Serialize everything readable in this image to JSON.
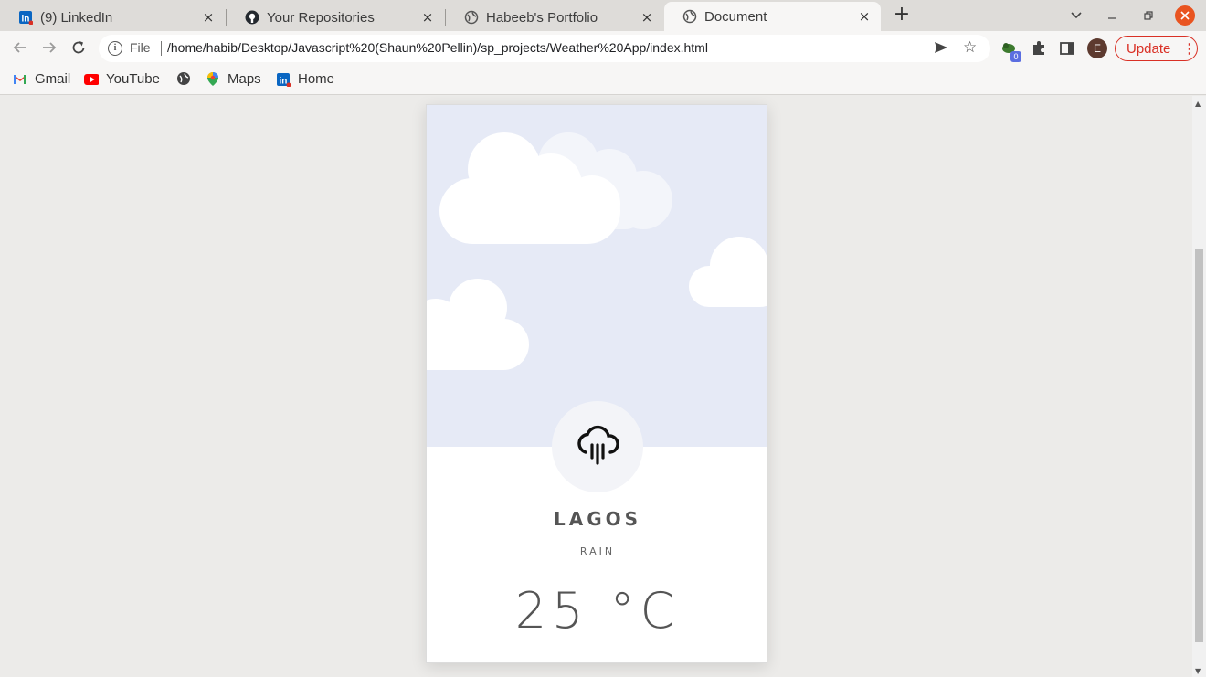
{
  "browser": {
    "tabs": [
      {
        "title": "(9) LinkedIn",
        "icon": "linkedin-icon",
        "active": false
      },
      {
        "title": "Your Repositories",
        "icon": "github-icon",
        "active": false
      },
      {
        "title": "Habeeb's Portfolio",
        "icon": "globe-icon",
        "active": false
      },
      {
        "title": "Document",
        "icon": "globe-icon",
        "active": true
      }
    ],
    "close_glyph": "×",
    "new_tab_glyph": "+",
    "address": {
      "scheme_label": "File",
      "url": "/home/habib/Desktop/Javascript%20(Shaun%20Pellin)/sp_projects/Weather%20App/index.html"
    },
    "profile_initial": "E",
    "extension_badge": "0",
    "update_label": "Update",
    "bookmarks": [
      {
        "label": "Gmail",
        "icon": "gmail-icon"
      },
      {
        "label": "YouTube",
        "icon": "youtube-icon"
      },
      {
        "label": "",
        "icon": "globe-icon"
      },
      {
        "label": "Maps",
        "icon": "maps-icon"
      },
      {
        "label": "Home",
        "icon": "linkedin-icon"
      }
    ]
  },
  "weather_card": {
    "city": "LAGOS",
    "condition": "RAIN",
    "temperature": "25 °C",
    "icon": "rain-cloud-icon",
    "colors": {
      "sky": "#e6eaf6",
      "card": "#ffffff",
      "text": "#555555"
    }
  }
}
